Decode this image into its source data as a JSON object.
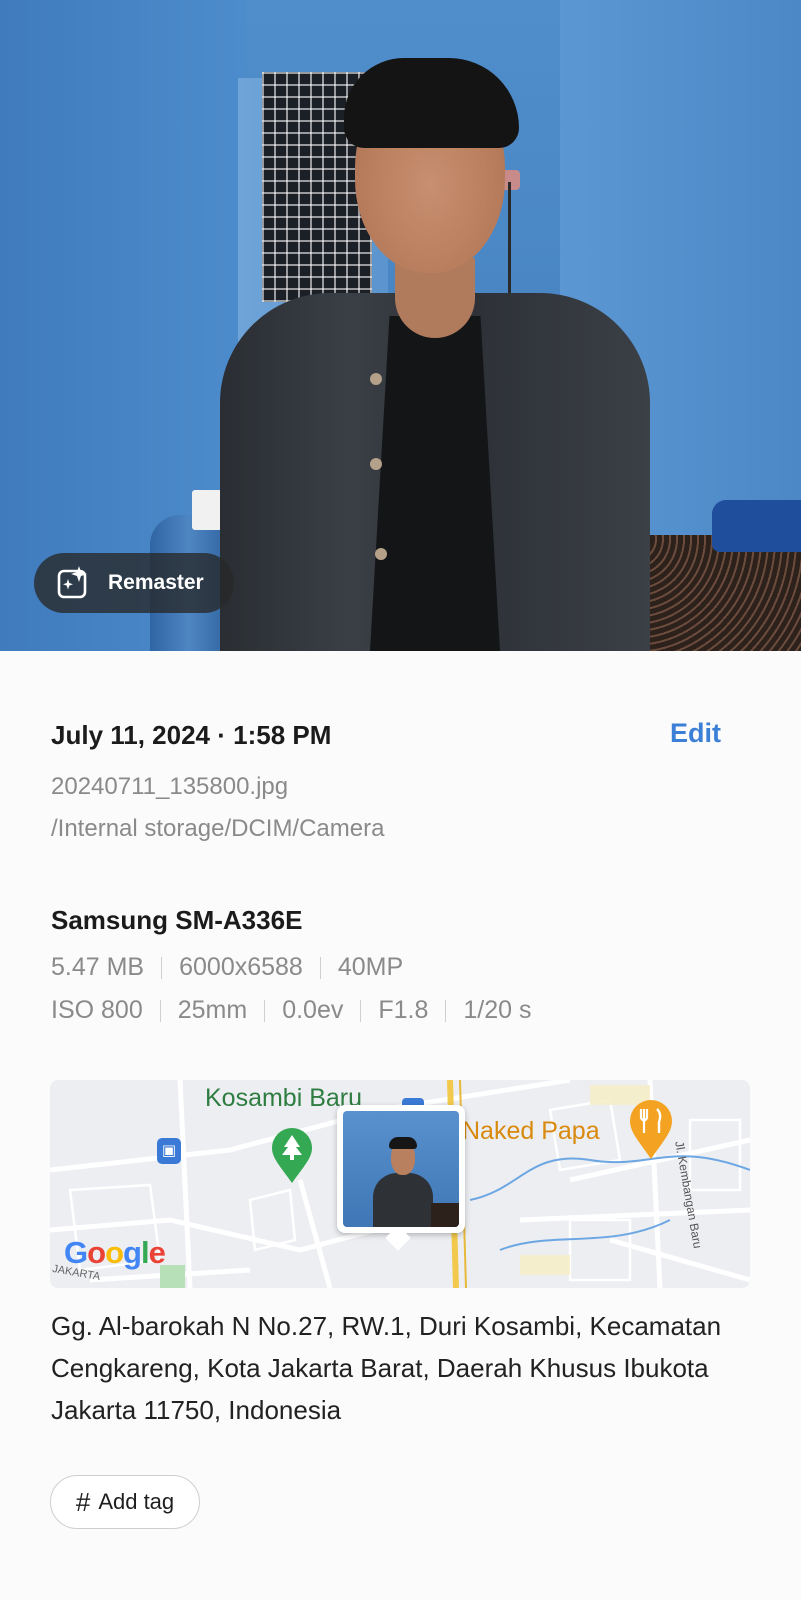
{
  "photo": {
    "remaster_label": "Remaster"
  },
  "details": {
    "datetime": "July 11, 2024 · 1:58 PM",
    "edit_label": "Edit",
    "filename": "20240711_135800.jpg",
    "path": "/Internal storage/DCIM/Camera",
    "device": "Samsung SM-A336E",
    "specs_row1": [
      "5.47 MB",
      "6000x6588",
      "40MP"
    ],
    "specs_row2": [
      "ISO 800",
      "25mm",
      "0.0ev",
      "F1.8",
      "1/20 s"
    ]
  },
  "map": {
    "label_area": "Kosambi Baru",
    "label_poi": "Naked Papa",
    "label_street": "Jl. Kembangan Baru",
    "label_city": "JAKARTA",
    "google_letters": [
      "G",
      "o",
      "o",
      "g",
      "l",
      "e"
    ],
    "google_colors": [
      "#4285F4",
      "#EA4335",
      "#FBBC05",
      "#4285F4",
      "#34A853",
      "#EA4335"
    ]
  },
  "address": "Gg. Al-barokah N No.27, RW.1, Duri Kosambi, Kecamatan Cengkareng, Kota Jakarta Barat, Daerah Khusus Ibukota Jakarta 11750, Indonesia",
  "add_tag": {
    "icon": "#",
    "label": "Add tag"
  }
}
